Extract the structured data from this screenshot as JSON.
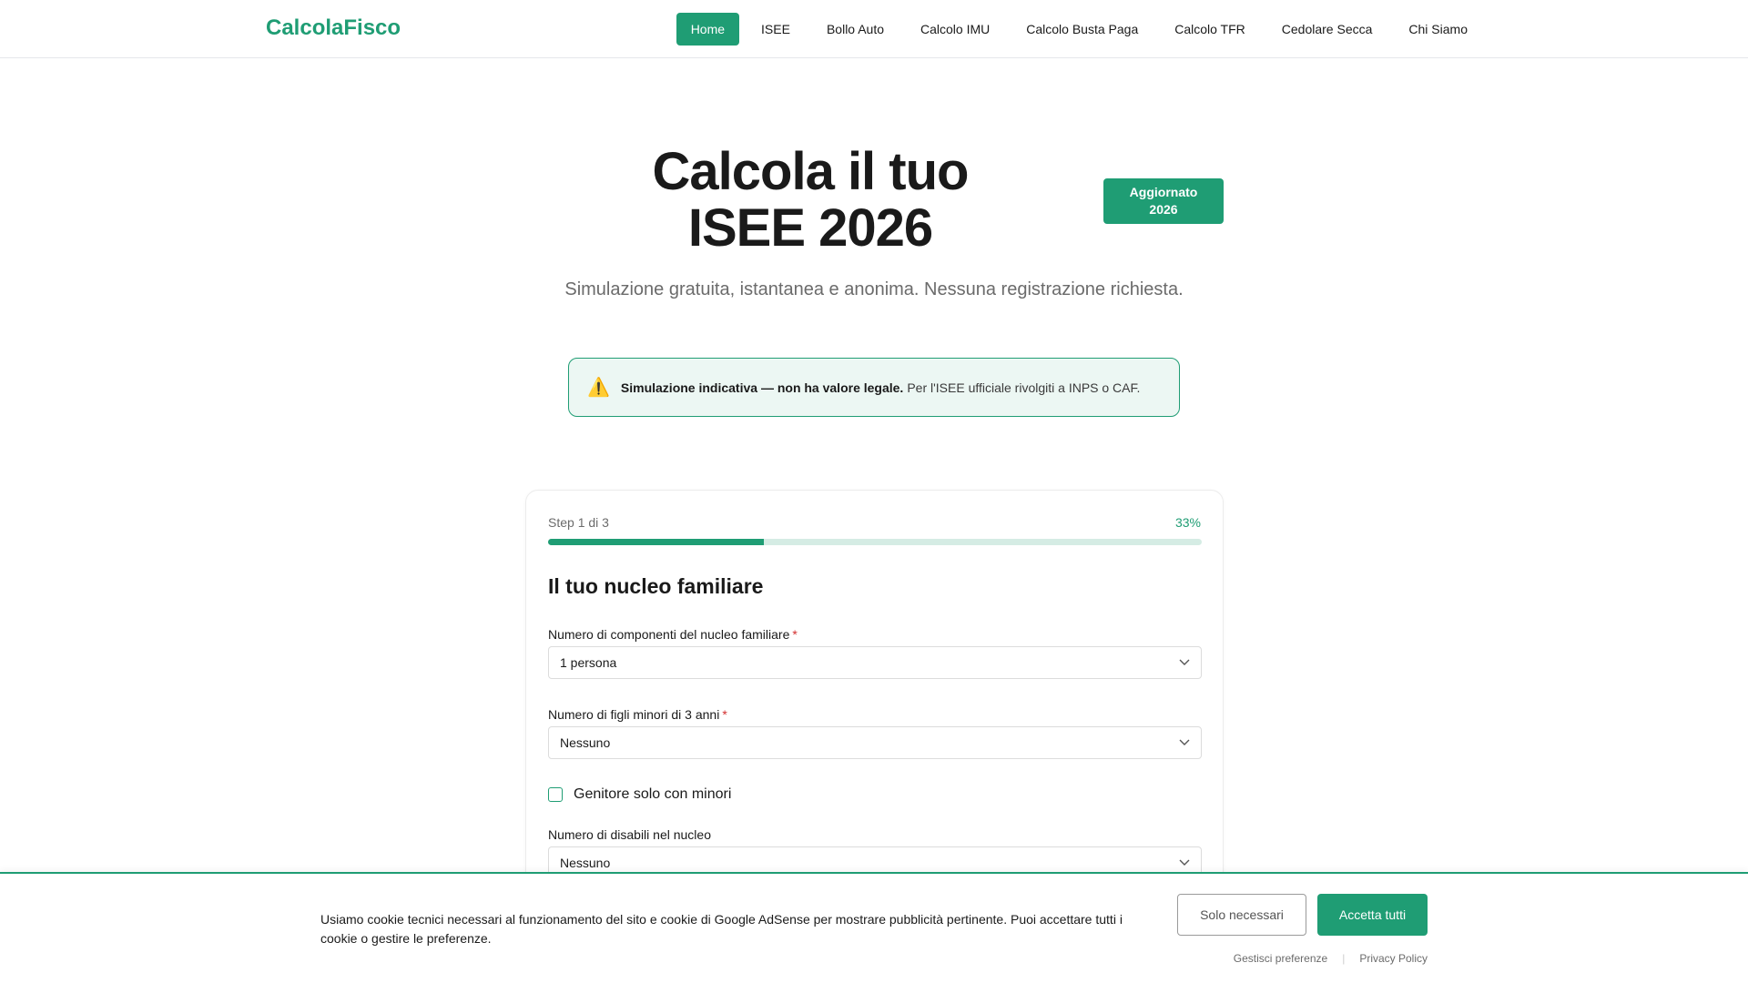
{
  "header": {
    "logo": "CalcolaFisco",
    "nav": [
      {
        "label": "Home",
        "active": true
      },
      {
        "label": "ISEE"
      },
      {
        "label": "Bollo Auto"
      },
      {
        "label": "Calcolo IMU"
      },
      {
        "label": "Calcolo Busta Paga"
      },
      {
        "label": "Calcolo TFR"
      },
      {
        "label": "Cedolare Secca"
      },
      {
        "label": "Chi Siamo"
      }
    ]
  },
  "hero": {
    "title_line1": "Calcola il tuo",
    "title_line2": "ISEE 2026",
    "badge_line1": "Aggiornato",
    "badge_line2": "2026",
    "subtitle": "Simulazione gratuita, istantanea e anonima. Nessuna registrazione richiesta.",
    "notice_bold": "Simulazione indicativa — non ha valore legale.",
    "notice_text": "Per l'ISEE ufficiale rivolgiti a INPS o CAF."
  },
  "form": {
    "step_label": "Step 1 di 3",
    "step_percent": "33%",
    "progress": 0.33,
    "section_title": "Il tuo nucleo familiare",
    "fields": [
      {
        "label": "Numero di componenti del nucleo familiare",
        "required_mark": "*",
        "value": "1 persona"
      },
      {
        "label": "Numero di figli minori di 3 anni",
        "required_mark": "*",
        "value": "Nessuno"
      },
      {
        "label": "Numero di disabili nel nucleo",
        "value": "Nessuno"
      }
    ],
    "checkbox_label": "Genitore solo con minori"
  },
  "cookie": {
    "text": "Usiamo cookie tecnici necessari al funzionamento del sito e cookie di Google AdSense per mostrare pubblicità pertinente. Puoi accettare tutti i cookie o gestire le preferenze.",
    "btn_necessary": "Solo necessari",
    "btn_accept": "Accetta tutti",
    "link_manage": "Gestisci preferenze",
    "link_separator": "|",
    "link_privacy": "Privacy Policy"
  },
  "colors": {
    "accent": "#1f9d74",
    "notice_bg": "#ecf7f3",
    "progress_track": "#d5ece4"
  }
}
